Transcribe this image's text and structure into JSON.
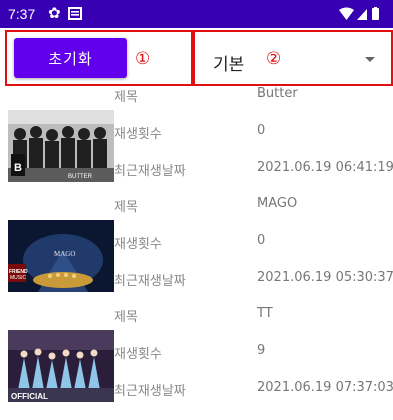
{
  "status_bar": {
    "time": "7:37",
    "icons": [
      "gear-icon",
      "notification-icon",
      "wifi-icon",
      "signal-icon",
      "battery-icon"
    ]
  },
  "toolbar": {
    "reset_label": "초기화",
    "marker_1": "①",
    "sort_select_value": "기본",
    "marker_2": "②"
  },
  "labels": {
    "title": "제목",
    "play_count": "재생횟수",
    "last_played": "최근재생날짜"
  },
  "songs": [
    {
      "title": "Butter",
      "play_count": "0",
      "last_played": "2021.06.19 06:41:19",
      "thumb_text": "BUTTER"
    },
    {
      "title": "MAGO",
      "play_count": "0",
      "last_played": "2021.06.19 05:30:37",
      "thumb_text": "MAGO"
    },
    {
      "title": "TT",
      "play_count": "9",
      "last_played": "2021.06.19 07:37:03",
      "thumb_text": "OFFICIAL"
    }
  ],
  "colors": {
    "status_bar": "#3700b3",
    "accent": "#6200ee",
    "annotation": "#e01010"
  }
}
